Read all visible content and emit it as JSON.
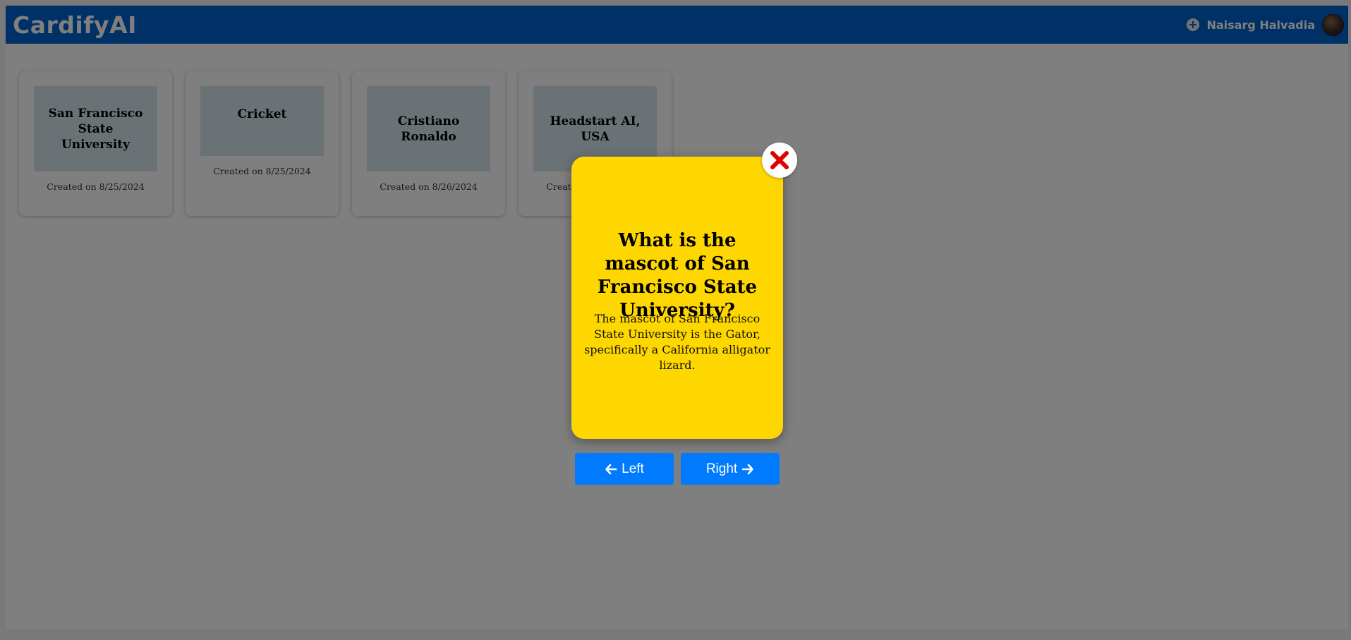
{
  "app": {
    "brand": "CardifyAI"
  },
  "header": {
    "user_name": "Naisarg Halvadia",
    "plus_icon": "plus-circle-icon",
    "accent": "#0062cc"
  },
  "decks": [
    {
      "title": "San Francisco State University",
      "created": "Created on 8/25/2024"
    },
    {
      "title": "Cricket",
      "created": "Created on 8/25/2024"
    },
    {
      "title": "Cristiano Ronaldo",
      "created": "Created on 8/26/2024"
    },
    {
      "title": "Headstart AI, USA",
      "created": "Created on 8/26/2024"
    }
  ],
  "modal": {
    "question": "What is the mascot of San Francisco State University?",
    "answer": "The mascot of San Francisco State University is the Gator, specifically a California alligator lizard.",
    "card_color": "#ffd700",
    "close_icon": "close-x-icon",
    "close_color": "#e00000",
    "left_label": "Left",
    "right_label": "Right",
    "left_icon": "arrow-left-icon",
    "right_icon": "arrow-right-icon",
    "button_color": "#007bff"
  }
}
